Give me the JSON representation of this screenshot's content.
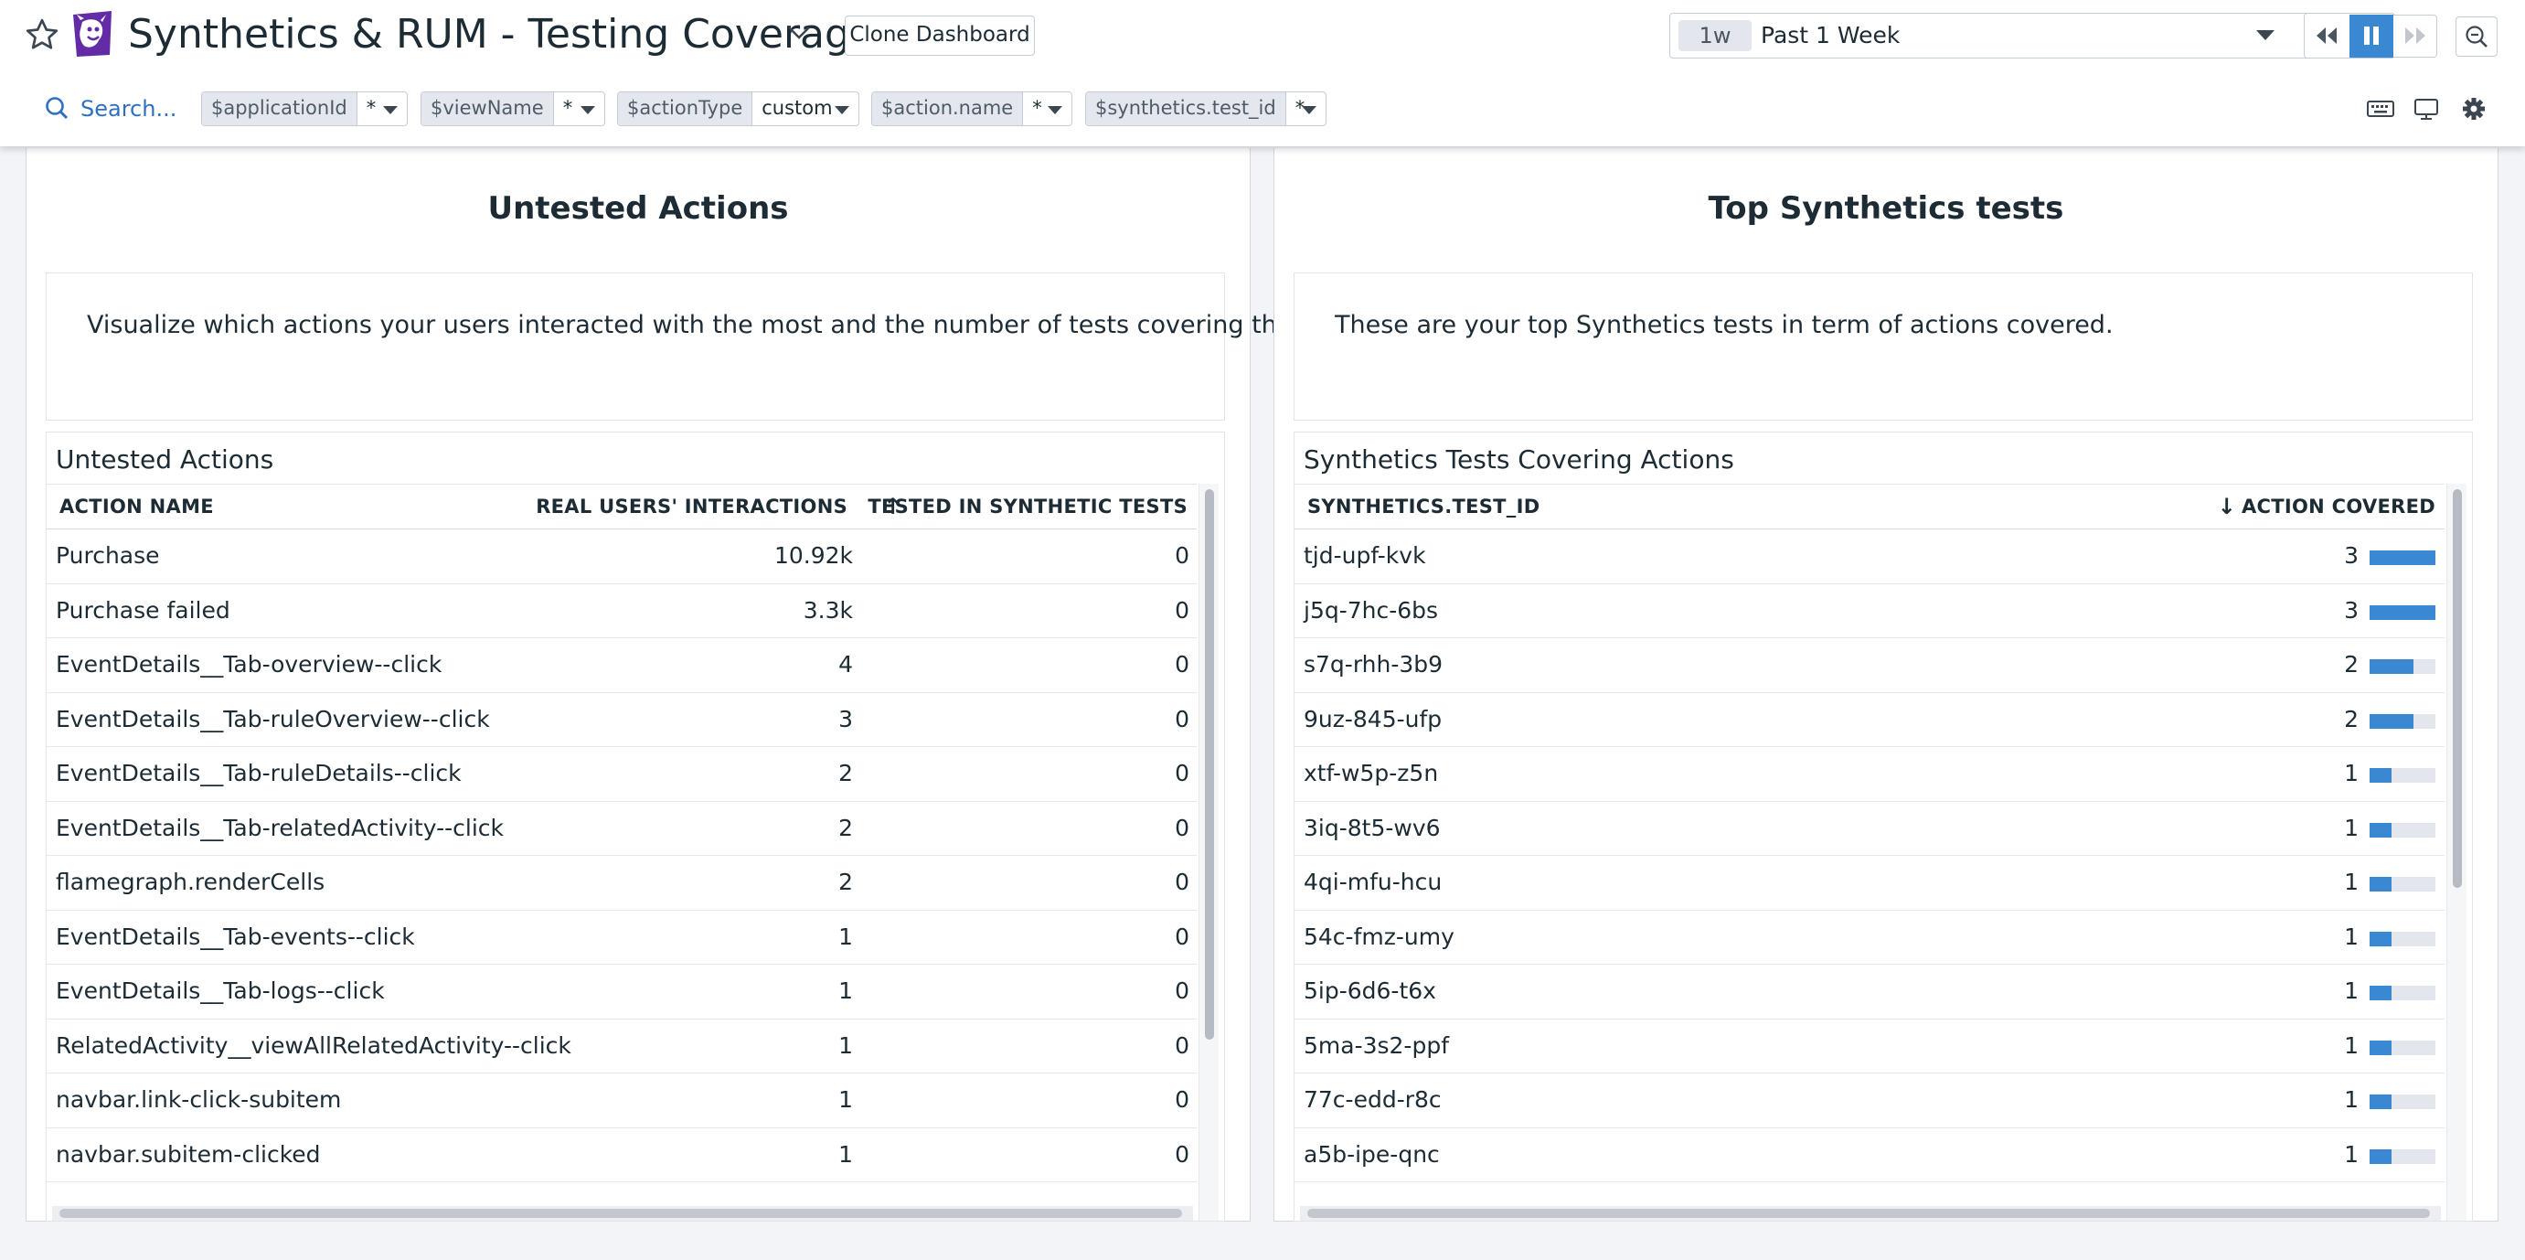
{
  "header": {
    "title": "Synthetics & RUM - Testing Coverage",
    "clone_label": "Clone Dashboard",
    "time_badge": "1w",
    "time_label": "Past 1 Week",
    "search_label": "Search..."
  },
  "template_vars": [
    {
      "name": "$applicationId",
      "value": "*"
    },
    {
      "name": "$viewName",
      "value": "*"
    },
    {
      "name": "$actionType",
      "value": "custom"
    },
    {
      "name": "$action.name",
      "value": "*"
    },
    {
      "name": "$synthetics.test_id",
      "value": "*"
    }
  ],
  "left_panel": {
    "title": "Untested Actions",
    "note": "Visualize which actions your users interacted with the most and the number of tests covering them.",
    "table_title": "Untested Actions",
    "columns": {
      "action_name": "ACTION NAME",
      "interactions": "REAL USERS' INTERACTIONS",
      "tested": "TESTED IN SYNTHETIC TESTS",
      "sort_arrow": "↑"
    },
    "rows": [
      {
        "name": "Purchase",
        "interactions": "10.92k",
        "tested": "0"
      },
      {
        "name": "Purchase failed",
        "interactions": "3.3k",
        "tested": "0"
      },
      {
        "name": "EventDetails__Tab-overview--click",
        "interactions": "4",
        "tested": "0"
      },
      {
        "name": "EventDetails__Tab-ruleOverview--click",
        "interactions": "3",
        "tested": "0"
      },
      {
        "name": "EventDetails__Tab-ruleDetails--click",
        "interactions": "2",
        "tested": "0"
      },
      {
        "name": "EventDetails__Tab-relatedActivity--click",
        "interactions": "2",
        "tested": "0"
      },
      {
        "name": "flamegraph.renderCells",
        "interactions": "2",
        "tested": "0"
      },
      {
        "name": "EventDetails__Tab-events--click",
        "interactions": "1",
        "tested": "0"
      },
      {
        "name": "EventDetails__Tab-logs--click",
        "interactions": "1",
        "tested": "0"
      },
      {
        "name": "RelatedActivity__viewAllRelatedActivity--click",
        "interactions": "1",
        "tested": "0"
      },
      {
        "name": "navbar.link-click-subitem",
        "interactions": "1",
        "tested": "0"
      },
      {
        "name": "navbar.subitem-clicked",
        "interactions": "1",
        "tested": "0"
      }
    ]
  },
  "right_panel": {
    "title": "Top Synthetics tests",
    "note": "These are your top Synthetics tests in term of actions covered.",
    "table_title": "Synthetics Tests Covering Actions",
    "columns": {
      "test_id": "SYNTHETICS.TEST_ID",
      "covered": "ACTION COVERED",
      "sort_arrow": "↓"
    },
    "bar_max": 3,
    "rows": [
      {
        "id": "tjd-upf-kvk",
        "covered": 3
      },
      {
        "id": "j5q-7hc-6bs",
        "covered": 3
      },
      {
        "id": "s7q-rhh-3b9",
        "covered": 2
      },
      {
        "id": "9uz-845-ufp",
        "covered": 2
      },
      {
        "id": "xtf-w5p-z5n",
        "covered": 1
      },
      {
        "id": "3iq-8t5-wv6",
        "covered": 1
      },
      {
        "id": "4qi-mfu-hcu",
        "covered": 1
      },
      {
        "id": "54c-fmz-umy",
        "covered": 1
      },
      {
        "id": "5ip-6d6-t6x",
        "covered": 1
      },
      {
        "id": "5ma-3s2-ppf",
        "covered": 1
      },
      {
        "id": "77c-edd-r8c",
        "covered": 1
      },
      {
        "id": "a5b-ipe-qnc",
        "covered": 1
      }
    ]
  },
  "colors": {
    "accent": "#3a87d2",
    "link": "#2f6fc0",
    "logo": "#632ca6"
  },
  "icons": [
    "star-icon",
    "datadog-logo",
    "chevron-down-icon",
    "rewind-icon",
    "pause-icon",
    "fast-forward-icon",
    "zoom-out-icon",
    "search-icon",
    "keyboard-icon",
    "monitor-icon",
    "gear-icon"
  ]
}
